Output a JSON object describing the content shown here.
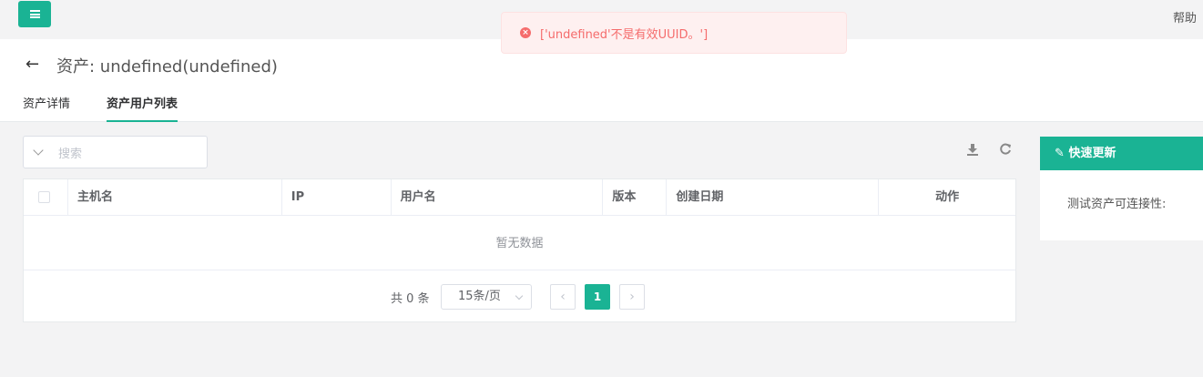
{
  "topbar": {
    "help_label": "帮助"
  },
  "toast": {
    "message": "['undefined'不是有效UUID。']",
    "status_color": "#f56c6c"
  },
  "header": {
    "title": "资产: undefined(undefined)",
    "tabs": [
      {
        "label": "资产详情",
        "active": false
      },
      {
        "label": "资产用户列表",
        "active": true
      }
    ]
  },
  "search": {
    "placeholder": "搜索"
  },
  "table": {
    "columns": [
      "主机名",
      "IP",
      "用户名",
      "版本",
      "创建日期",
      "动作"
    ],
    "empty_text": "暂无数据"
  },
  "pagination": {
    "total_label": "共 0 条",
    "page_size": "15条/页",
    "current_page": "1",
    "prev_icon": "‹",
    "next_icon": "›"
  },
  "quick_update": {
    "title": "快速更新",
    "test_label": "测试资产可连接性:"
  },
  "colors": {
    "accent": "#1ab394"
  }
}
